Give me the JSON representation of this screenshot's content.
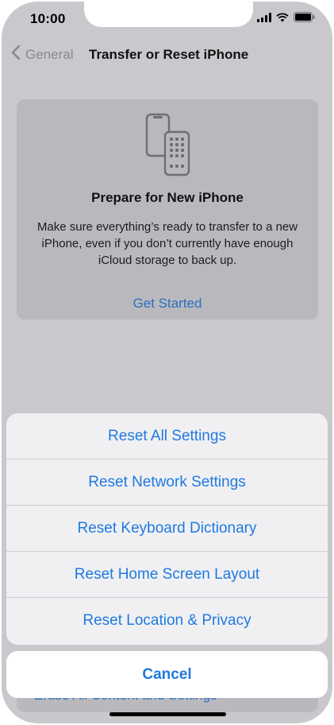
{
  "status_bar": {
    "time": "10:00",
    "icons": [
      "signal-icon",
      "wifi-icon",
      "battery-icon"
    ]
  },
  "nav": {
    "back_label": "General",
    "title": "Transfer or Reset iPhone"
  },
  "prepare_card": {
    "icon": "phones-transfer-icon",
    "title": "Prepare for New iPhone",
    "description": "Make sure everything’s ready to transfer to a new iPhone, even if you don’t currently have enough iCloud storage to back up.",
    "action": "Get Started"
  },
  "obscured_row": {
    "label": "Erase All Content and Settings"
  },
  "reset_sheet": {
    "options": [
      "Reset All Settings",
      "Reset Network Settings",
      "Reset Keyboard Dictionary",
      "Reset Home Screen Layout",
      "Reset Location & Privacy"
    ],
    "cancel_label": "Cancel"
  },
  "colors": {
    "accent": "#1f7ae0",
    "dimmed_background": "#c9c9cd",
    "sheet_background": "#f0f0f2"
  }
}
